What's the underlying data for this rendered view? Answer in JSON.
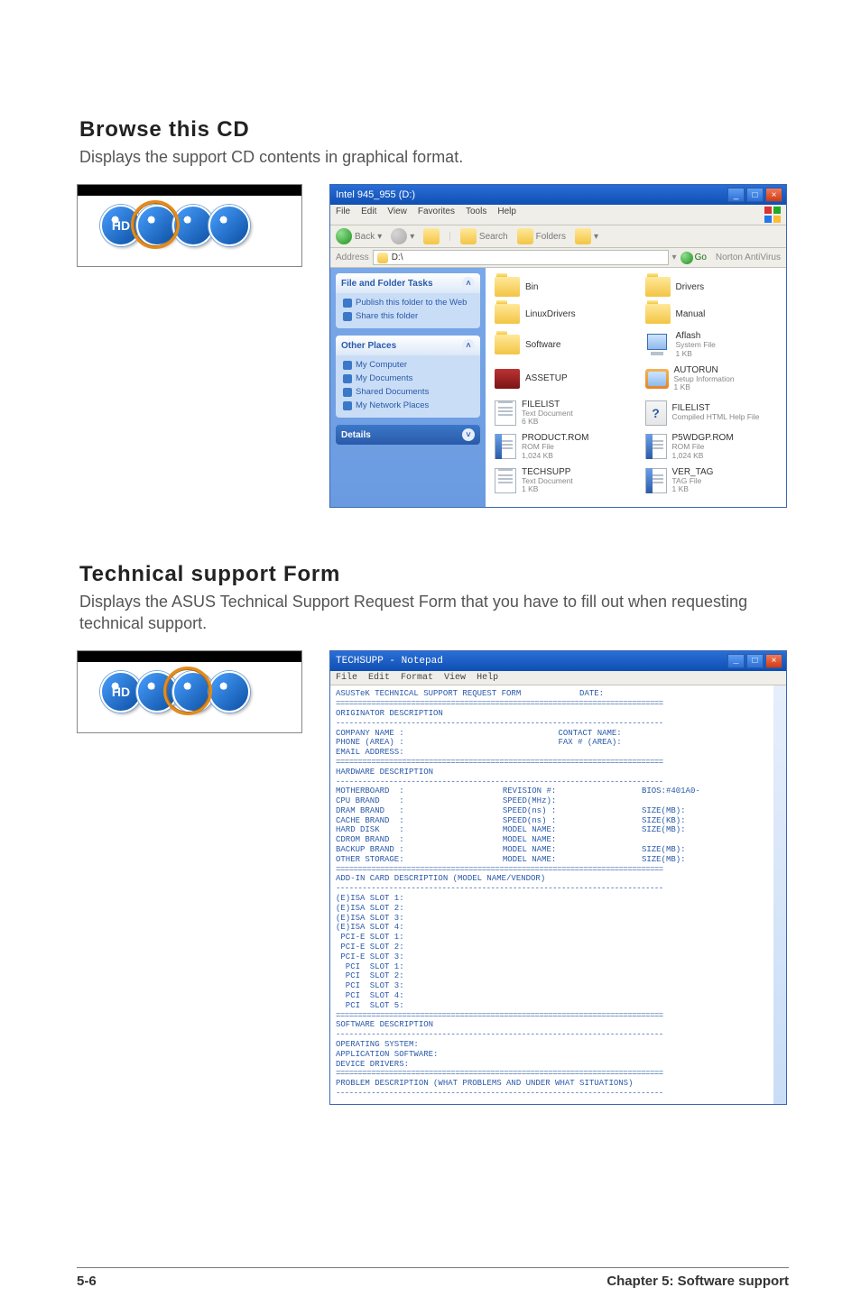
{
  "sections": {
    "browse": {
      "heading": "Browse this CD",
      "desc": "Displays the support CD contents in graphical format."
    },
    "techform": {
      "heading": "Technical support Form",
      "desc": "Displays the ASUS Technical Support Request Form that you have to fill out when requesting technical support."
    }
  },
  "orbs": [
    "HD",
    "",
    "",
    ""
  ],
  "explorer": {
    "title": "Intel 945_955 (D:)",
    "menu": [
      "File",
      "Edit",
      "View",
      "Favorites",
      "Tools",
      "Help"
    ],
    "toolbar": {
      "back": "Back",
      "search": "Search",
      "folders": "Folders"
    },
    "address_label": "Address",
    "address_value": "D:\\",
    "go": "Go",
    "links": "Norton AntiVirus",
    "panels": {
      "tasks": {
        "title": "File and Folder Tasks",
        "items": [
          "Publish this folder to the Web",
          "Share this folder"
        ]
      },
      "places": {
        "title": "Other Places",
        "items": [
          "My Computer",
          "My Documents",
          "Shared Documents",
          "My Network Places"
        ]
      },
      "details": {
        "title": "Details"
      }
    },
    "contents": [
      {
        "kind": "folder",
        "name": "Bin",
        "sub": ""
      },
      {
        "kind": "folder",
        "name": "Drivers",
        "sub": ""
      },
      {
        "kind": "folder",
        "name": "LinuxDrivers",
        "sub": ""
      },
      {
        "kind": "folder",
        "name": "Manual",
        "sub": ""
      },
      {
        "kind": "folder",
        "name": "Software",
        "sub": ""
      },
      {
        "kind": "sys",
        "name": "Aflash",
        "sub": "System File\n1 KB"
      },
      {
        "kind": "soft",
        "name": "ASSETUP",
        "sub": ""
      },
      {
        "kind": "app",
        "name": "AUTORUN",
        "sub": "Setup Information\n1 KB"
      },
      {
        "kind": "text",
        "name": "FILELIST",
        "sub": "Text Document\n6 KB"
      },
      {
        "kind": "chm",
        "name": "FILELIST",
        "sub": "Compiled HTML Help File"
      },
      {
        "kind": "textb",
        "name": "PRODUCT.ROM",
        "sub": "ROM File\n1,024 KB"
      },
      {
        "kind": "textb",
        "name": "P5WDGP.ROM",
        "sub": "ROM File\n1,024 KB"
      },
      {
        "kind": "text",
        "name": "TECHSUPP",
        "sub": "Text Document\n1 KB"
      },
      {
        "kind": "textb",
        "name": "VER_TAG",
        "sub": "TAG File\n1 KB"
      }
    ]
  },
  "notepad": {
    "title": "TECHSUPP - Notepad",
    "menu": [
      "File",
      "Edit",
      "Format",
      "View",
      "Help"
    ],
    "header": "ASUSTeK TECHNICAL SUPPORT REQUEST FORM            DATE:",
    "orig_hdr": "ORIGINATOR DESCRIPTION",
    "orig_left": "COMPANY NAME :\nPHONE (AREA) :\nEMAIL ADDRESS:",
    "orig_right": "CONTACT NAME:\nFAX # (AREA):",
    "hw_hdr": "HARDWARE DESCRIPTION",
    "hw_c1": "MOTHERBOARD  :\nCPU BRAND    :\nDRAM BRAND   :\nCACHE BRAND  :\nHARD DISK    :\nCDROM BRAND  :\nBACKUP BRAND :\nOTHER STORAGE:",
    "hw_c2": "REVISION #:\nSPEED(MHz):\nSPEED(ns) :\nSPEED(ns) :\nMODEL NAME:\nMODEL NAME:\nMODEL NAME:\nMODEL NAME:",
    "hw_c3": "BIOS:#401A0-\n\nSIZE(MB):\nSIZE(KB):\nSIZE(MB):\n\nSIZE(MB):\nSIZE(MB):",
    "addin_hdr": "ADD-IN CARD DESCRIPTION (MODEL NAME/VENDOR)",
    "slots": "(E)ISA SLOT 1:\n(E)ISA SLOT 2:\n(E)ISA SLOT 3:\n(E)ISA SLOT 4:\n PCI-E SLOT 1:\n PCI-E SLOT 2:\n PCI-E SLOT 3:\n  PCI  SLOT 1:\n  PCI  SLOT 2:\n  PCI  SLOT 3:\n  PCI  SLOT 4:\n  PCI  SLOT 5:",
    "sw_hdr": "SOFTWARE DESCRIPTION",
    "sw_body": "OPERATING SYSTEM:\nAPPLICATION SOFTWARE:\nDEVICE DRIVERS:",
    "prob_hdr": "PROBLEM DESCRIPTION (WHAT PROBLEMS AND UNDER WHAT SITUATIONS)"
  },
  "footer": {
    "page": "5-6",
    "chapter": "Chapter 5: Software support"
  }
}
